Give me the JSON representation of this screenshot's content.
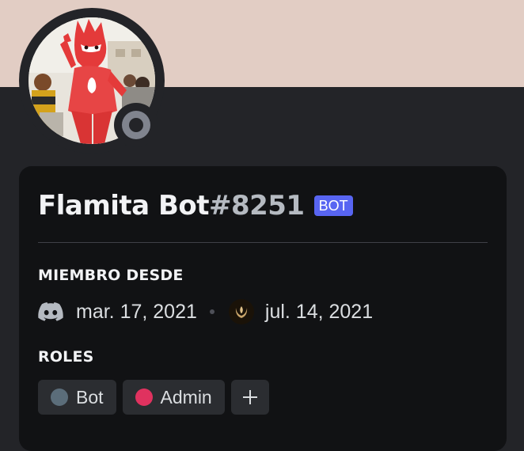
{
  "profile": {
    "username": "Flamita Bot",
    "discriminator": "#8251",
    "bot_tag": "BOT",
    "status": "offline",
    "banner_color": "#e2cdc4"
  },
  "member_since": {
    "title": "MIEMBRO DESDE",
    "discord_date": "mar. 17, 2021",
    "discord_icon": "discord-logo-icon",
    "server_date": "jul. 14, 2021",
    "server_icon": "server-flame-icon"
  },
  "roles": {
    "title": "ROLES",
    "items": [
      {
        "label": "Bot",
        "color": "#5b6d7a"
      },
      {
        "label": "Admin",
        "color": "#e0325f"
      }
    ],
    "add_icon": "plus-icon"
  },
  "colors": {
    "accent": "#5865f2",
    "card_bg": "#111214",
    "page_bg": "#232428"
  }
}
